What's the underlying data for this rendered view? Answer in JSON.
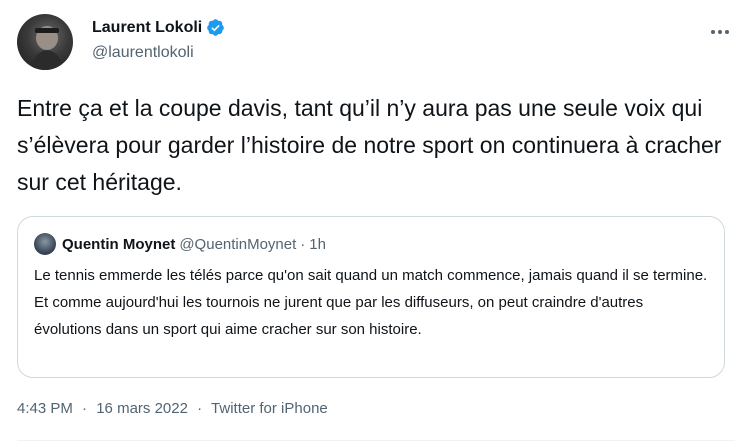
{
  "author": {
    "display_name": "Laurent Lokoli",
    "handle": "@laurentlokoli",
    "verified": true
  },
  "tweet": {
    "text": "Entre ça et la coupe davis, tant qu’il n’y aura pas une seule voix qui s’élèvera pour garder l’histoire de notre sport on continuera à cracher sur cet héritage."
  },
  "quote": {
    "display_name": "Quentin Moynet",
    "handle": "@QuentinMoynet",
    "separator": "·",
    "time": "1h",
    "text": "Le tennis emmerde les télés parce qu'on sait quand un match commence, jamais quand il se termine. Et comme aujourd'hui les tournois ne jurent que par les diffuseurs, on peut craindre d'autres évolutions dans un sport qui aime cracher sur son histoire."
  },
  "meta": {
    "time": "4:43 PM",
    "sep1": "·",
    "date": "16 mars 2022",
    "sep2": "·",
    "source": "Twitter for iPhone"
  },
  "icons": {
    "verified": "verified-badge-icon",
    "more": "more-horizontal-icon"
  },
  "colors": {
    "verified_blue": "#1d9bf0",
    "secondary_text": "#536471",
    "border": "#cfd9de"
  }
}
